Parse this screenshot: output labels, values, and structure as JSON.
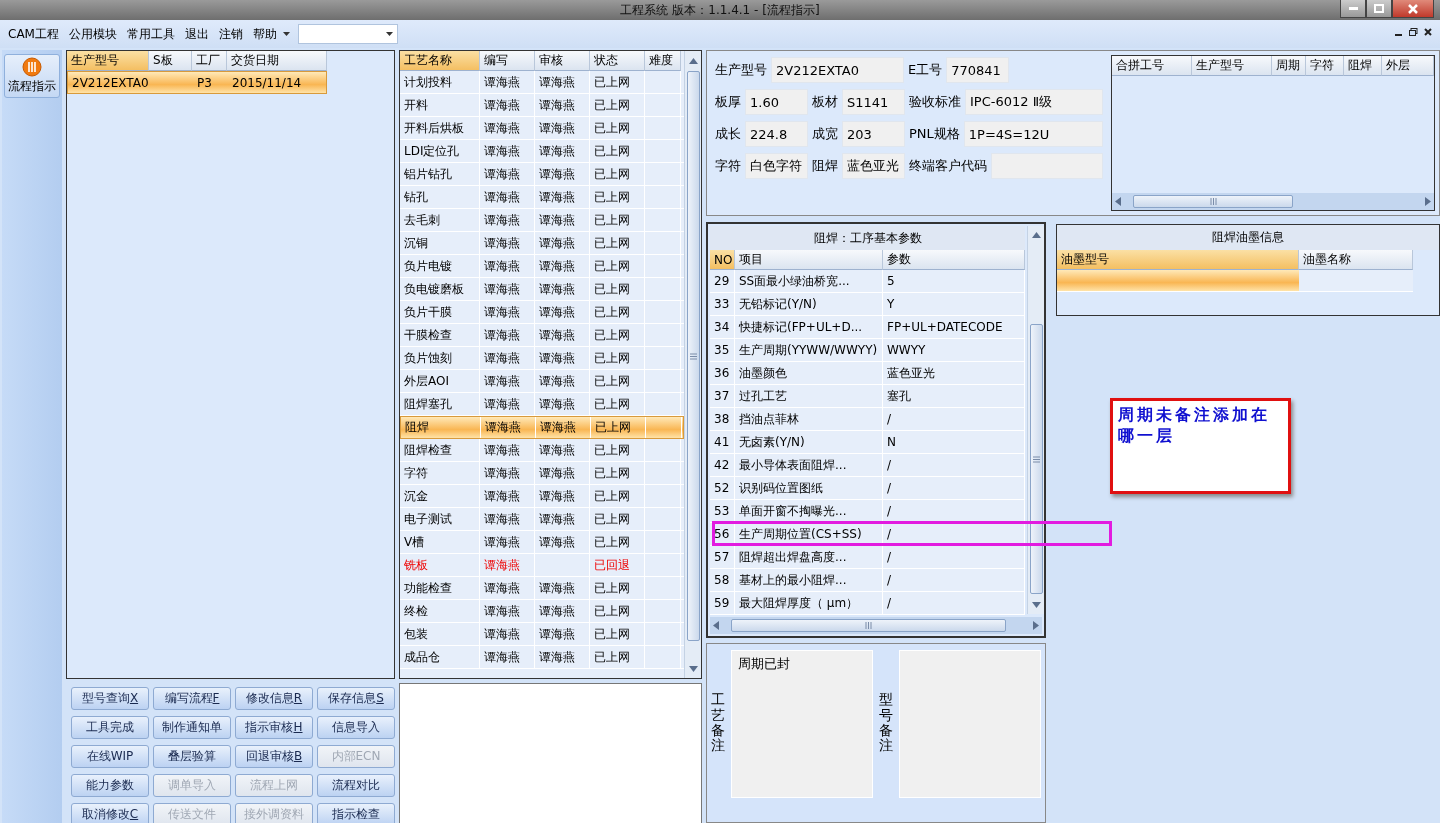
{
  "window": {
    "title": "工程系统  版本：1.1.4.1 - [流程指示]"
  },
  "menu": {
    "items": [
      "CAM工程",
      "公用模块",
      "常用工具",
      "退出",
      "注销",
      "帮助"
    ]
  },
  "sidebar": {
    "items": [
      {
        "label": "流程指示",
        "selected": true
      }
    ]
  },
  "orders_table": {
    "columns": [
      {
        "label": "生产型号",
        "selected": true
      },
      {
        "label": "S板",
        "selected": false
      },
      {
        "label": "工厂",
        "selected": false
      },
      {
        "label": "交货日期",
        "selected": false
      }
    ],
    "rows": [
      {
        "cells": [
          "2V212EXTA0",
          null,
          "P3",
          "2015/11/14"
        ],
        "selected": true
      }
    ]
  },
  "process_table": {
    "columns": [
      {
        "label": "工艺名称",
        "selected": true
      },
      {
        "label": "编写",
        "selected": false
      },
      {
        "label": "审核",
        "selected": false
      },
      {
        "label": "状态",
        "selected": false
      },
      {
        "label": "难度",
        "selected": false
      }
    ],
    "rows": [
      {
        "name": "计划投料",
        "writer": "谭海燕",
        "reviewer": "谭海燕",
        "status": "已上网",
        "selected": false,
        "rejected": false
      },
      {
        "name": "开料",
        "writer": "谭海燕",
        "reviewer": "谭海燕",
        "status": "已上网",
        "selected": false,
        "rejected": false
      },
      {
        "name": "开料后烘板",
        "writer": "谭海燕",
        "reviewer": "谭海燕",
        "status": "已上网",
        "selected": false,
        "rejected": false
      },
      {
        "name": "LDI定位孔",
        "writer": "谭海燕",
        "reviewer": "谭海燕",
        "status": "已上网",
        "selected": false,
        "rejected": false
      },
      {
        "name": "铝片钻孔",
        "writer": "谭海燕",
        "reviewer": "谭海燕",
        "status": "已上网",
        "selected": false,
        "rejected": false
      },
      {
        "name": "钻孔",
        "writer": "谭海燕",
        "reviewer": "谭海燕",
        "status": "已上网",
        "selected": false,
        "rejected": false
      },
      {
        "name": "去毛刺",
        "writer": "谭海燕",
        "reviewer": "谭海燕",
        "status": "已上网",
        "selected": false,
        "rejected": false
      },
      {
        "name": "沉铜",
        "writer": "谭海燕",
        "reviewer": "谭海燕",
        "status": "已上网",
        "selected": false,
        "rejected": false
      },
      {
        "name": "负片电镀",
        "writer": "谭海燕",
        "reviewer": "谭海燕",
        "status": "已上网",
        "selected": false,
        "rejected": false
      },
      {
        "name": "负电镀磨板",
        "writer": "谭海燕",
        "reviewer": "谭海燕",
        "status": "已上网",
        "selected": false,
        "rejected": false
      },
      {
        "name": "负片干膜",
        "writer": "谭海燕",
        "reviewer": "谭海燕",
        "status": "已上网",
        "selected": false,
        "rejected": false
      },
      {
        "name": "干膜检查",
        "writer": "谭海燕",
        "reviewer": "谭海燕",
        "status": "已上网",
        "selected": false,
        "rejected": false
      },
      {
        "name": "负片蚀刻",
        "writer": "谭海燕",
        "reviewer": "谭海燕",
        "status": "已上网",
        "selected": false,
        "rejected": false
      },
      {
        "name": "外层AOI",
        "writer": "谭海燕",
        "reviewer": "谭海燕",
        "status": "已上网",
        "selected": false,
        "rejected": false
      },
      {
        "name": "阻焊塞孔",
        "writer": "谭海燕",
        "reviewer": "谭海燕",
        "status": "已上网",
        "selected": false,
        "rejected": false
      },
      {
        "name": "阻焊",
        "writer": "谭海燕",
        "reviewer": "谭海燕",
        "status": "已上网",
        "selected": true,
        "rejected": false
      },
      {
        "name": "阻焊检查",
        "writer": "谭海燕",
        "reviewer": "谭海燕",
        "status": "已上网",
        "selected": false,
        "rejected": false
      },
      {
        "name": "字符",
        "writer": "谭海燕",
        "reviewer": "谭海燕",
        "status": "已上网",
        "selected": false,
        "rejected": false
      },
      {
        "name": "沉金",
        "writer": "谭海燕",
        "reviewer": "谭海燕",
        "status": "已上网",
        "selected": false,
        "rejected": false
      },
      {
        "name": "电子测试",
        "writer": "谭海燕",
        "reviewer": "谭海燕",
        "status": "已上网",
        "selected": false,
        "rejected": false
      },
      {
        "name": "V槽",
        "writer": "谭海燕",
        "reviewer": "谭海燕",
        "status": "已上网",
        "selected": false,
        "rejected": false
      },
      {
        "name": "铣板",
        "writer": "谭海燕",
        "status": "已回退",
        "selected": false,
        "rejected": true
      },
      {
        "name": "功能检查",
        "writer": "谭海燕",
        "reviewer": "谭海燕",
        "status": "已上网",
        "selected": false,
        "rejected": false
      },
      {
        "name": "终检",
        "writer": "谭海燕",
        "reviewer": "谭海燕",
        "status": "已上网",
        "selected": false,
        "rejected": false
      },
      {
        "name": "包装",
        "writer": "谭海燕",
        "reviewer": "谭海燕",
        "status": "已上网",
        "selected": false,
        "rejected": false
      },
      {
        "name": "成品仓",
        "writer": "谭海燕",
        "reviewer": "谭海燕",
        "status": "已上网",
        "selected": false,
        "rejected": false
      }
    ]
  },
  "buttons": [
    {
      "label": "型号查询",
      "shortcut": "X",
      "disabled": false
    },
    {
      "label": "编写流程",
      "shortcut": "F",
      "disabled": false
    },
    {
      "label": "修改信息",
      "shortcut": "R",
      "disabled": false
    },
    {
      "label": "保存信息",
      "shortcut": "S",
      "disabled": false
    },
    {
      "label": "工具完成",
      "disabled": false
    },
    {
      "label": "制作通知单",
      "disabled": false
    },
    {
      "label": "指示审核",
      "shortcut": "H",
      "disabled": false
    },
    {
      "label": "信息导入",
      "disabled": false
    },
    {
      "label": "在线WIP",
      "disabled": false
    },
    {
      "label": "叠层验算",
      "disabled": false
    },
    {
      "label": "回退审核",
      "shortcut": "B",
      "disabled": false
    },
    {
      "label": "内部ECN",
      "disabled": true
    },
    {
      "label": "能力参数",
      "disabled": false
    },
    {
      "label": "调单导入",
      "disabled": true
    },
    {
      "label": "流程上网",
      "disabled": true
    },
    {
      "label": "流程对比",
      "disabled": false
    },
    {
      "label": "取消修改",
      "shortcut": "C",
      "disabled": false
    },
    {
      "label": "传送文件",
      "disabled": true
    },
    {
      "label": "接外调资料",
      "disabled": true
    },
    {
      "label": "指示检查",
      "disabled": false
    }
  ],
  "info": {
    "rows": [
      [
        {
          "label": "生产型号",
          "value": "2V212EXTA0",
          "colspan": 2
        },
        {
          "label": "E工号",
          "value": "770841"
        }
      ],
      [
        {
          "label": "板厚",
          "value": "1.60"
        },
        {
          "label": "板材",
          "value": "S1141"
        },
        {
          "label": "验收标准",
          "value": "IPC-6012 Ⅱ级"
        }
      ],
      [
        {
          "label": "成长",
          "value": "224.8"
        },
        {
          "label": "成宽",
          "value": "203"
        },
        {
          "label": "PNL规格",
          "value": "1P=4S=12U"
        }
      ],
      [
        {
          "label": "字符",
          "value": "白色字符"
        },
        {
          "label": "阻焊",
          "value": "蓝色亚光"
        },
        {
          "label": "终端客户代码"
        }
      ]
    ]
  },
  "merge_table": {
    "columns": [
      "合拼工号",
      "生产型号",
      "周期",
      "字符",
      "阻焊",
      "外层"
    ]
  },
  "params_table": {
    "title": "阻焊：工序基本参数",
    "columns": [
      {
        "label": "NO",
        "selected": true
      },
      {
        "label": "项目",
        "selected": false
      },
      {
        "label": "参数",
        "selected": false
      }
    ],
    "rows": [
      {
        "no": "29",
        "item": "SS面最小绿油桥宽...",
        "value": "5",
        "highlighted": false
      },
      {
        "no": "33",
        "item": "无铅标记(Y/N)",
        "value": "Y",
        "highlighted": false
      },
      {
        "no": "34",
        "item": "快捷标记(FP+UL+D...",
        "value": "FP+UL+DATECODE",
        "highlighted": false
      },
      {
        "no": "35",
        "item": "生产周期(YYWW/WWYY)",
        "value": "WWYY",
        "highlighted": false
      },
      {
        "no": "36",
        "item": "油墨颜色",
        "value": "蓝色亚光",
        "highlighted": false
      },
      {
        "no": "37",
        "item": "过孔工艺",
        "value": "塞孔",
        "highlighted": false
      },
      {
        "no": "38",
        "item": "挡油点菲林",
        "value": "/",
        "highlighted": false
      },
      {
        "no": "41",
        "item": "无卤素(Y/N)",
        "value": "N",
        "highlighted": false
      },
      {
        "no": "42",
        "item": "最小导体表面阻焊...",
        "value": "/",
        "highlighted": false
      },
      {
        "no": "52",
        "item": "识别码位置图纸",
        "value": "/",
        "highlighted": false
      },
      {
        "no": "53",
        "item": "单面开窗不掏曝光...",
        "value": "/",
        "highlighted": false
      },
      {
        "no": "56",
        "item": "生产周期位置(CS+SS)",
        "value": "/",
        "highlighted": true
      },
      {
        "no": "57",
        "item": "阻焊超出焊盘高度...",
        "value": "/",
        "highlighted": false
      },
      {
        "no": "58",
        "item": "基材上的最小阻焊...",
        "value": "/",
        "highlighted": false
      },
      {
        "no": "59",
        "item": "最大阻焊厚度（ μm）",
        "value": "/",
        "highlighted": false
      }
    ]
  },
  "ink_table": {
    "title": "阻焊油墨信息",
    "columns": [
      {
        "label": "油墨型号",
        "selected": true
      },
      {
        "label": "油墨名称",
        "selected": false
      }
    ],
    "rows": [
      {
        "selected": true
      }
    ]
  },
  "callout": {
    "text": "周期未备注添加在哪一层"
  },
  "remarks": [
    {
      "label": "工艺备注",
      "value": "周期已封"
    },
    {
      "label": "型号备注"
    }
  ]
}
